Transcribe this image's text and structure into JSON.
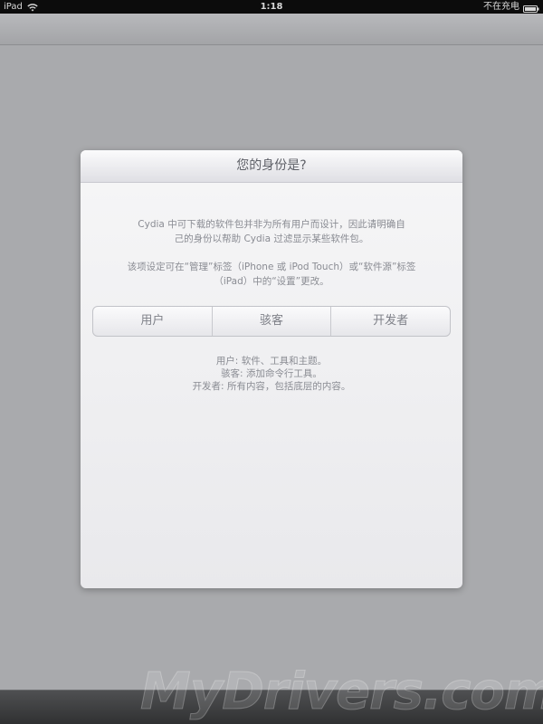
{
  "status_bar": {
    "device": "iPad",
    "time": "1:18",
    "charging": "不在充电",
    "wifi_icon": "wifi-icon",
    "battery_icon": "battery-icon"
  },
  "dialog": {
    "title": "您的身份是?",
    "intro": "Cydia 中可下载的软件包并非为所有用户而设计，因此请明确自己的身份以帮助 Cydia 过滤显示某些软件包。",
    "setting_note": "该项设定可在“管理”标签（iPhone 或 iPod Touch）或“软件源”标签（iPad）中的“设置”更改。",
    "segments": [
      "用户",
      "骇客",
      "开发者"
    ],
    "roles": [
      "用户: 软件、工具和主题。",
      "骇客: 添加命令行工具。",
      "开发者: 所有内容，包括底层的内容。"
    ]
  },
  "watermark": "MyDrivers.com"
}
